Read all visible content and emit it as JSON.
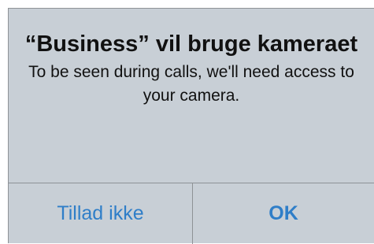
{
  "alert": {
    "title": "“Business” vil bruge kameraet",
    "message": "To be seen during calls, we'll need access to your camera.",
    "buttons": {
      "deny_label": "Tillad ikke",
      "allow_label": "OK"
    }
  },
  "colors": {
    "background": "#c8cfd6",
    "button_text": "#2f7ec8",
    "divider": "#8e9296"
  }
}
